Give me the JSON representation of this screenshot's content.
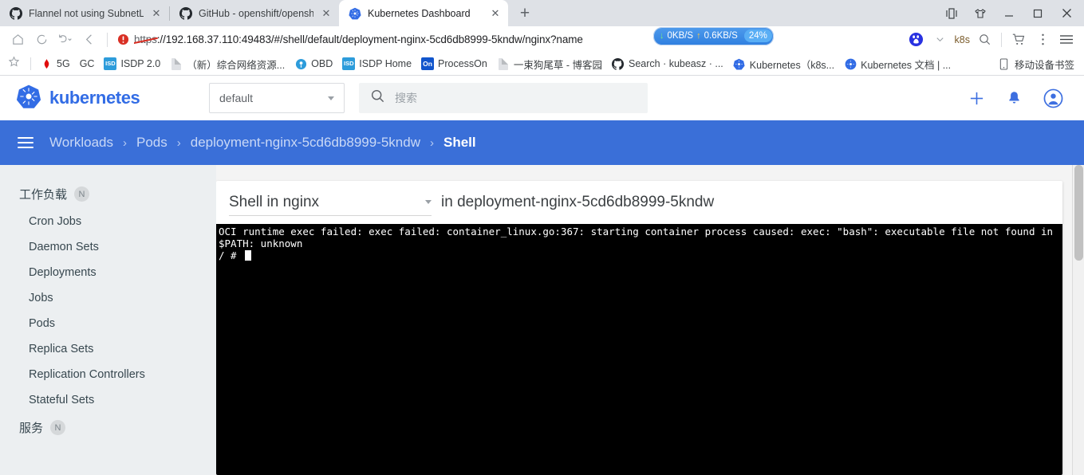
{
  "browser": {
    "tabs": [
      {
        "title": "Flannel not using SubnetLen",
        "favicon": "github-icon",
        "active": false
      },
      {
        "title": "GitHub - openshift/openshif",
        "favicon": "github-icon",
        "active": false
      },
      {
        "title": "Kubernetes Dashboard",
        "favicon": "kubernetes-icon",
        "active": true
      }
    ],
    "new_tab_label": "+",
    "close_label": "✕",
    "window_controls": [
      "device-toolbar-icon",
      "shirt-icon",
      "minimize-icon",
      "maximize-icon",
      "close-icon"
    ],
    "nav": {
      "home": "home-icon",
      "reload": "reload-icon",
      "history_back": "back-arrow-icon",
      "back": "chevron-left-icon"
    },
    "omnibox": {
      "warning_icon": "insecure-warning-icon",
      "scheme": "https",
      "url_rest": "://192.168.37.110:49483/#/shell/default/deployment-nginx-5cd6db8999-5kndw/nginx?name",
      "network_badge": {
        "download": "0KB/S",
        "upload": "0.6KB/S",
        "percent": "24%"
      }
    },
    "toolbar_right": {
      "baidu_icon": "baidu-icon",
      "chevron": "chevron-down-icon",
      "account_label": "k8s",
      "search_icon": "search-icon",
      "cart_icon": "shopping-cart-icon",
      "more_icon": "more-vertical-icon",
      "menu_icon": "hamburger-menu-icon"
    },
    "bookmarks": [
      {
        "label": "5G",
        "icon": "huawei-icon"
      },
      {
        "label": "GC",
        "icon": "none"
      },
      {
        "label": "ISDP 2.0",
        "icon": "isd-icon"
      },
      {
        "label": "（新）综合网络资源...",
        "icon": "doc-icon"
      },
      {
        "label": "OBD",
        "icon": "obd-icon"
      },
      {
        "label": "ISDP Home",
        "icon": "isd-icon"
      },
      {
        "label": "ProcessOn",
        "icon": "on-icon"
      },
      {
        "label": "一束狗尾草 - 博客园",
        "icon": "doc-icon"
      },
      {
        "label": "Search · kubeasz · ...",
        "icon": "github-icon"
      },
      {
        "label": "Kubernetes（k8s...",
        "icon": "kubernetes-icon"
      },
      {
        "label": "Kubernetes 文档 | ...",
        "icon": "kubernetes-icon"
      }
    ],
    "bookmarks_right": {
      "label": "移动设备书签",
      "icon": "mobile-bookmarks-icon"
    },
    "star_icon": "bookmark-star-icon"
  },
  "dashboard": {
    "logo_text": "kubernetes",
    "logo_icon": "kubernetes-wheel-icon",
    "namespace": {
      "value": "default",
      "caret": "chevron-down-icon"
    },
    "search": {
      "placeholder": "搜索",
      "icon": "search-icon"
    },
    "header_actions": [
      {
        "name": "create-button",
        "icon": "plus-icon"
      },
      {
        "name": "notifications-button",
        "icon": "bell-icon"
      },
      {
        "name": "account-button",
        "icon": "account-circle-icon"
      }
    ],
    "breadcrumb": {
      "menu_icon": "hamburger-menu-icon",
      "items": [
        "Workloads",
        "Pods",
        "deployment-nginx-5cd6db8999-5kndw",
        "Shell"
      ],
      "separator": "›"
    },
    "sidebar": {
      "groups": [
        {
          "label": "工作负载",
          "badge": "N",
          "items": [
            "Cron Jobs",
            "Daemon Sets",
            "Deployments",
            "Jobs",
            "Pods",
            "Replica Sets",
            "Replication Controllers",
            "Stateful Sets"
          ]
        },
        {
          "label": "服务",
          "badge": "N",
          "items": []
        }
      ]
    },
    "shell": {
      "select_value": "Shell in nginx",
      "select_caret": "chevron-down-icon",
      "context_label": "in deployment-nginx-5cd6db8999-5kndw",
      "terminal_output": "OCI runtime exec failed: exec failed: container_linux.go:367: starting container process caused: exec: \"bash\": executable file not found in $PATH: unknown\n/ # ",
      "prompt": "/ # "
    },
    "colors": {
      "primary": "#326ce5",
      "breadcrumb_bar": "#3a6fd8",
      "sidebar_bg": "#eceff1",
      "terminal_bg": "#000000",
      "terminal_fg": "#ffffff"
    }
  }
}
